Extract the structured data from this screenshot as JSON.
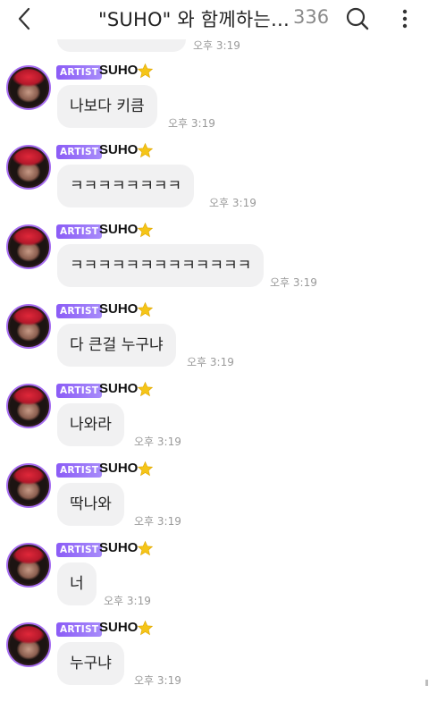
{
  "header": {
    "title": "\"SUHO\" 와 함께하는…",
    "member_count": "336",
    "back_icon": "chevron-left-icon",
    "search_icon": "search-icon",
    "more_icon": "more-vertical-icon"
  },
  "previous_message": {
    "time": "오후 3:19"
  },
  "messages": [
    {
      "badge": "ARTIST",
      "sender": "SUHO",
      "text": "나보다 키큼",
      "time": "오후 3:19"
    },
    {
      "badge": "ARTIST",
      "sender": "SUHO",
      "text": "ㅋㅋㅋㅋㅋㅋㅋㅋ",
      "time": "오후 3:19"
    },
    {
      "badge": "ARTIST",
      "sender": "SUHO",
      "text": "ㅋㅋㅋㅋㅋㅋㅋㅋㅋㅋㅋㅋㅋ",
      "time": "오후 3:19"
    },
    {
      "badge": "ARTIST",
      "sender": "SUHO",
      "text": "다 큰걸 누구냐",
      "time": "오후 3:19"
    },
    {
      "badge": "ARTIST",
      "sender": "SUHO",
      "text": "나와라",
      "time": "오후 3:19"
    },
    {
      "badge": "ARTIST",
      "sender": "SUHO",
      "text": "딱나와",
      "time": "오후 3:19"
    },
    {
      "badge": "ARTIST",
      "sender": "SUHO",
      "text": "너",
      "time": "오후 3:19"
    },
    {
      "badge": "ARTIST",
      "sender": "SUHO",
      "text": "누구냐",
      "time": "오후 3:19"
    }
  ],
  "colors": {
    "badge": "#8b5cf6",
    "bubble": "#f1f1f2",
    "star": "#f5c518",
    "avatar_ring": "#a66df0"
  }
}
